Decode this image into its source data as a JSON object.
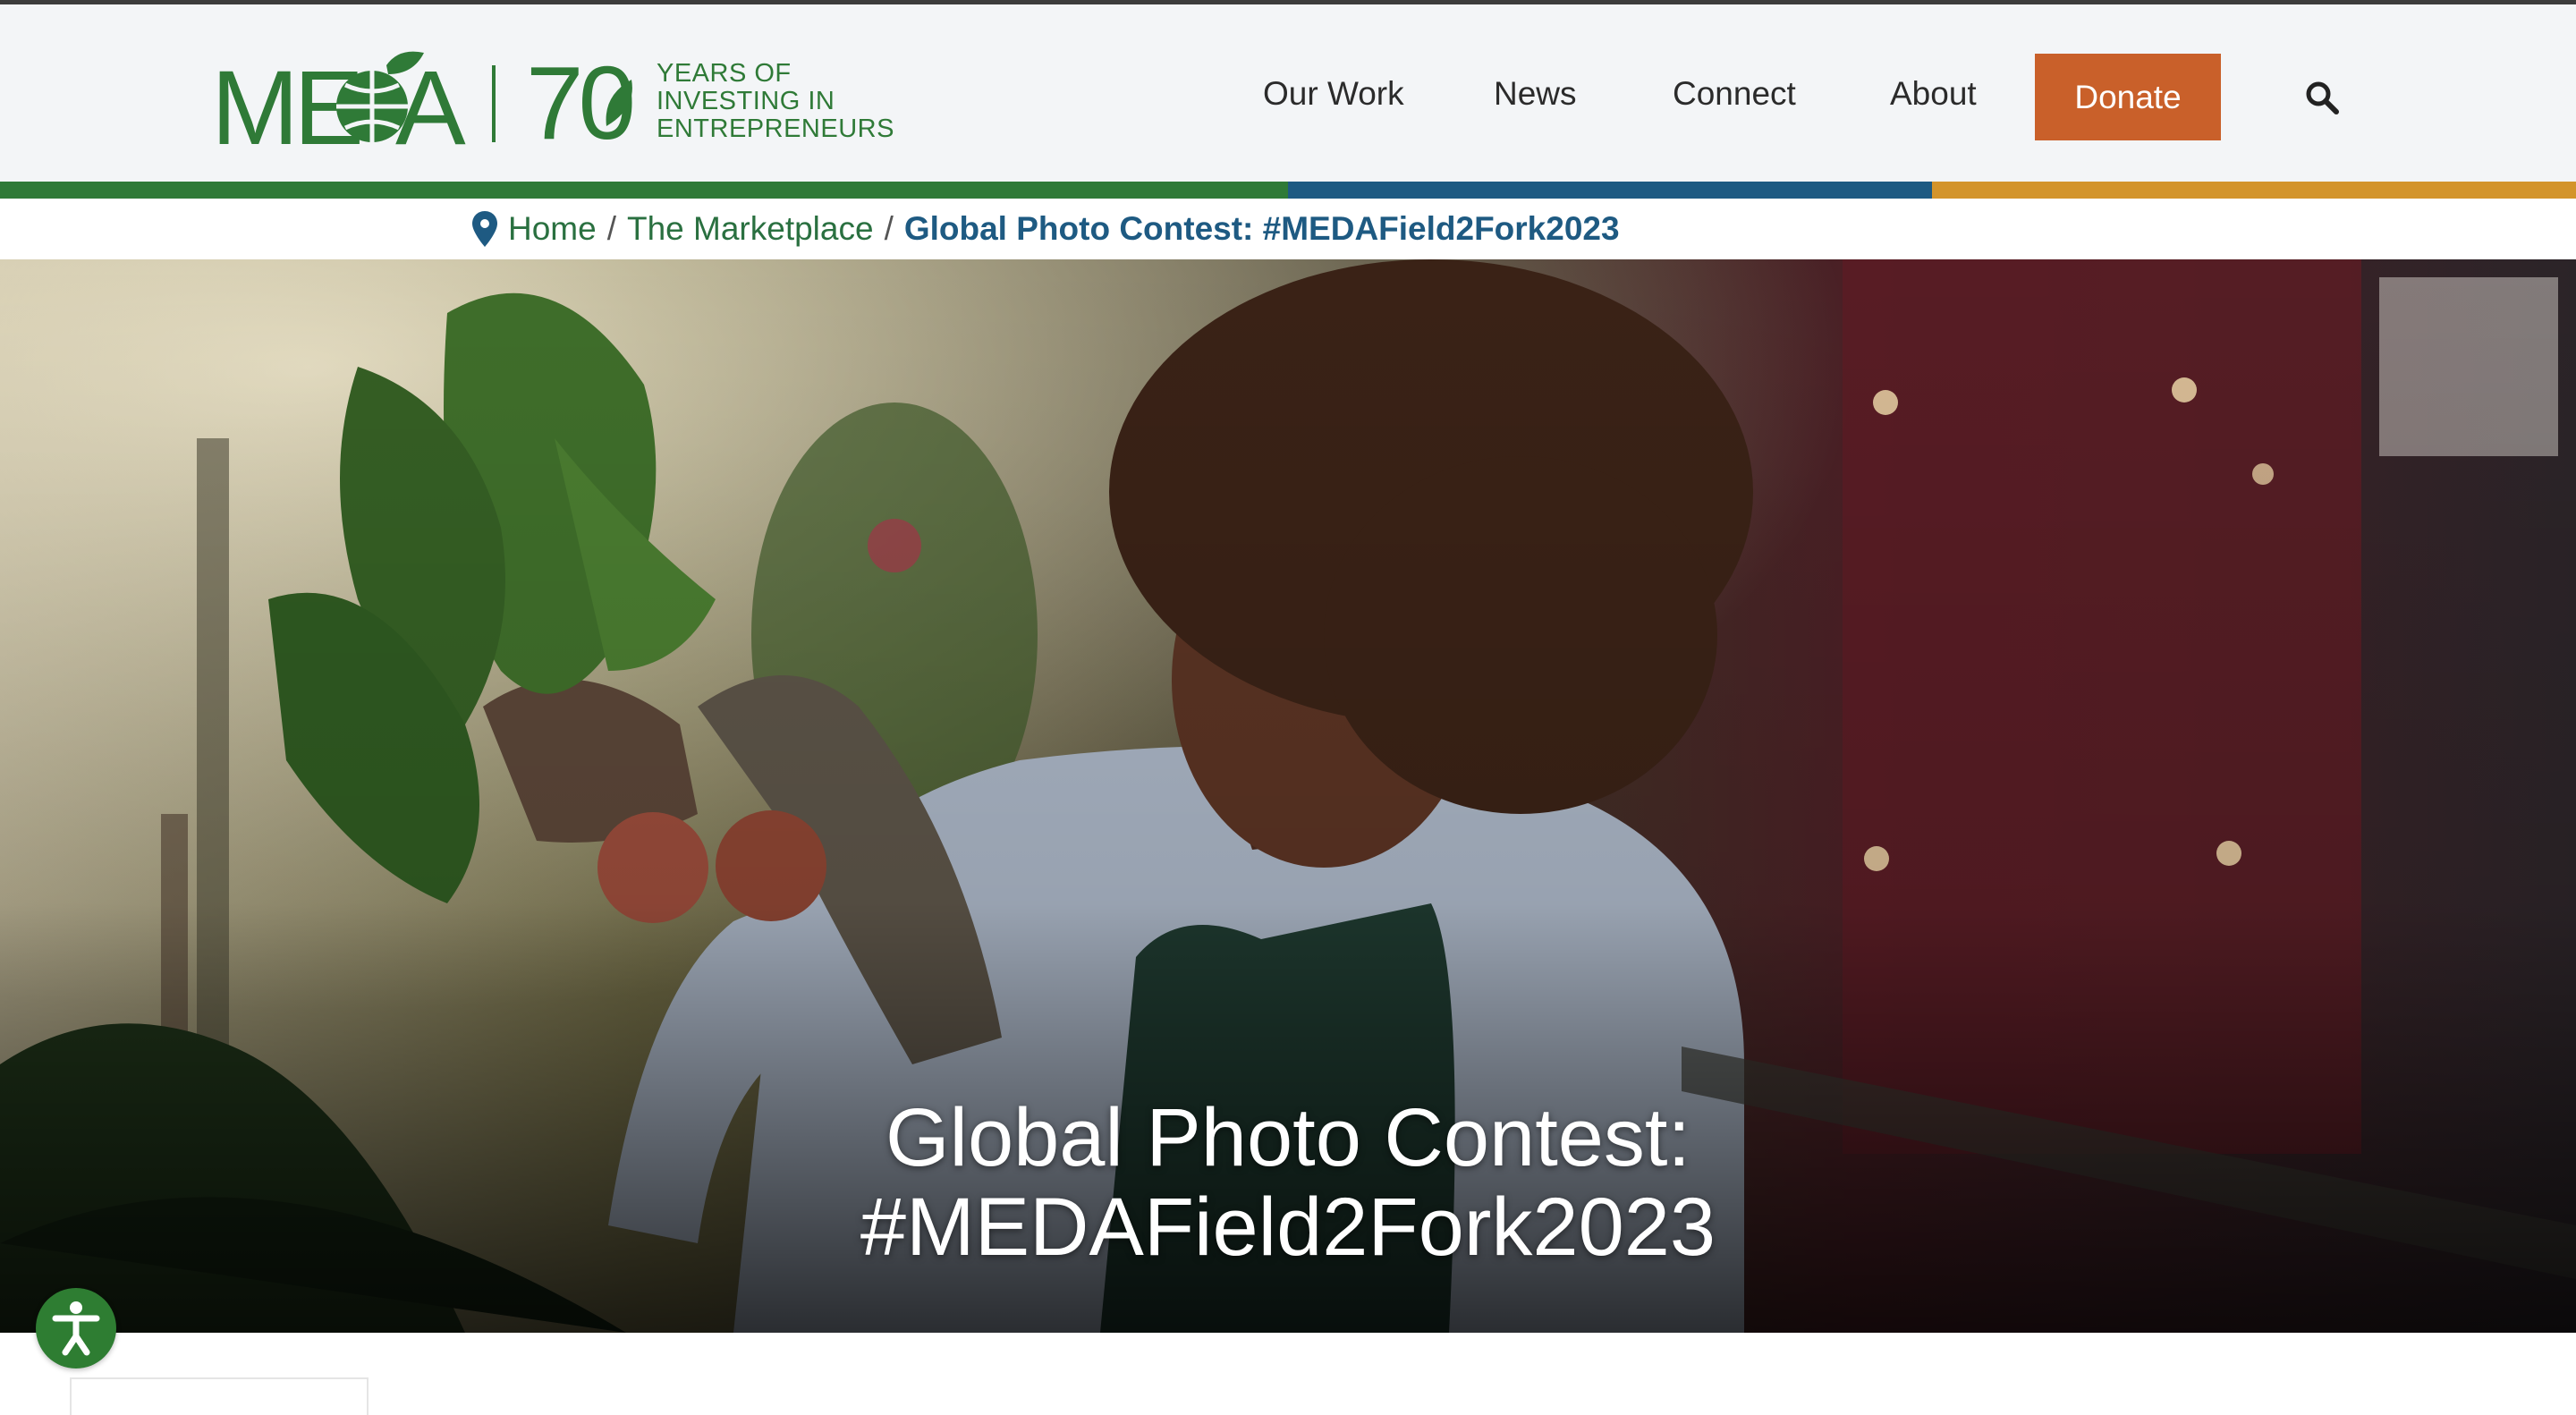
{
  "logo": {
    "brand": "MEDA",
    "years": "70",
    "tagline": [
      "YEARS OF",
      "INVESTING IN",
      "ENTREPRENEURS"
    ]
  },
  "nav": {
    "items": [
      {
        "label": "Our Work"
      },
      {
        "label": "News"
      },
      {
        "label": "Connect"
      },
      {
        "label": "About"
      }
    ],
    "donate_label": "Donate",
    "search_icon": "search-icon"
  },
  "colors": {
    "brand_green": "#2f7a37",
    "navy": "#1e5a82",
    "gold": "#d3942b",
    "donate": "#c9602a"
  },
  "breadcrumb": {
    "items": [
      "Home",
      "The Marketplace"
    ],
    "separator": "/",
    "current": "Global Photo Contest: #MEDAField2Fork2023"
  },
  "hero": {
    "title_line1": "Global Photo Contest:",
    "title_line2": "#MEDAField2Fork2023"
  },
  "accessibility": {
    "icon": "accessibility-icon"
  }
}
